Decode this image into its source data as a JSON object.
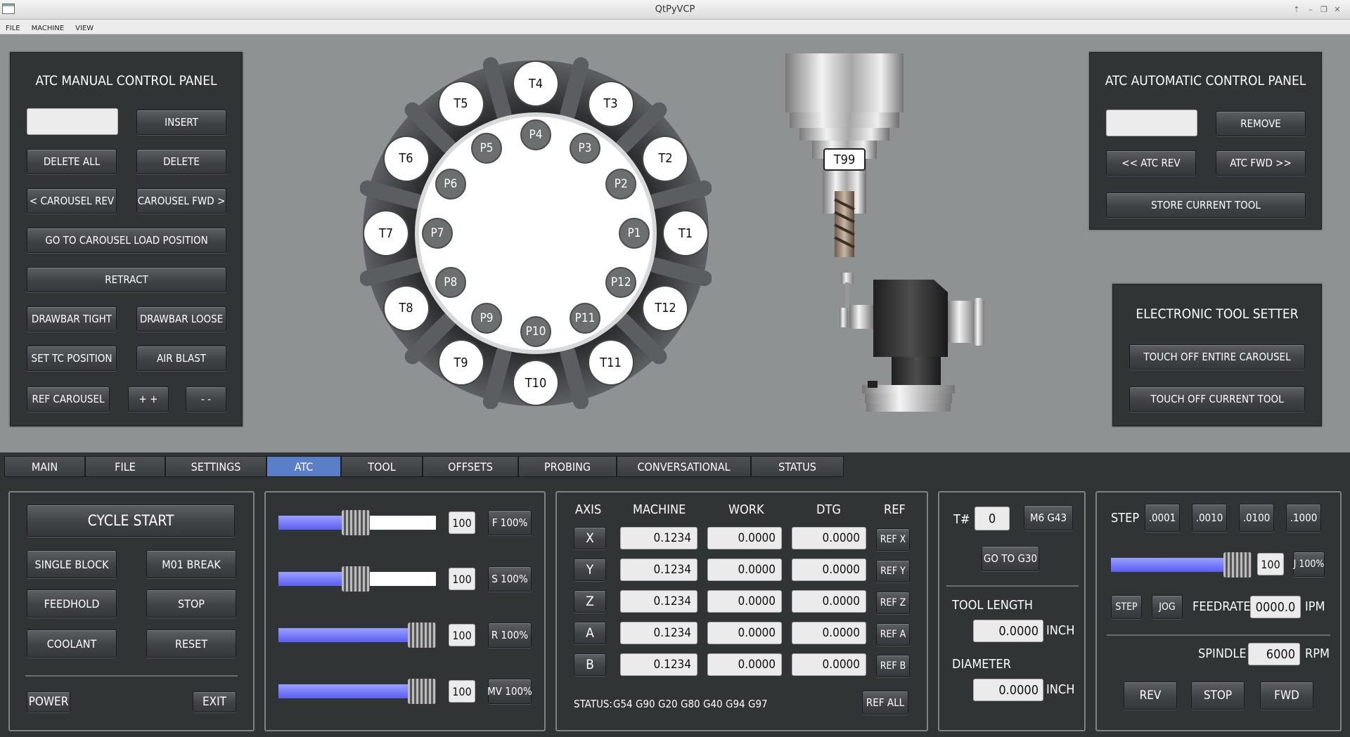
{
  "window": {
    "title": "QtPyVCP"
  },
  "menu": [
    "FILE",
    "MACHINE",
    "VIEW"
  ],
  "manual_panel": {
    "title": "ATC MANUAL CONTROL PANEL",
    "input_value": "",
    "insert": "INSERT",
    "delete_all": "DELETE ALL",
    "delete": "DELETE",
    "carousel_rev": "< CAROUSEL REV",
    "carousel_fwd": "CAROUSEL FWD >",
    "go_load": "GO TO CAROUSEL LOAD POSITION",
    "retract": "RETRACT",
    "drawbar_tight": "DRAWBAR TIGHT",
    "drawbar_loose": "DRAWBAR LOOSE",
    "set_tc": "SET TC POSITION",
    "air_blast": "AIR BLAST",
    "ref_carousel": "REF CAROUSEL",
    "plus": "+ +",
    "minus": "- -"
  },
  "carousel": {
    "tools": [
      "T1",
      "T2",
      "T3",
      "T4",
      "T5",
      "T6",
      "T7",
      "T8",
      "T9",
      "T10",
      "T11",
      "T12"
    ],
    "pockets": [
      "P1",
      "P2",
      "P3",
      "P4",
      "P5",
      "P6",
      "P7",
      "P8",
      "P9",
      "P10",
      "P11",
      "P12"
    ]
  },
  "spindle_tool": "T99",
  "auto_panel": {
    "title": "ATC AUTOMATIC CONTROL PANEL",
    "input_value": "",
    "remove": "REMOVE",
    "atc_rev": "<< ATC REV",
    "atc_fwd": "ATC FWD >>",
    "store": "STORE CURRENT TOOL"
  },
  "tool_setter": {
    "title": "ELECTRONIC TOOL SETTER",
    "touch_all": "TOUCH OFF ENTIRE CAROUSEL",
    "touch_current": "TOUCH OFF CURRENT TOOL"
  },
  "tabs": [
    "MAIN",
    "FILE",
    "SETTINGS",
    "ATC",
    "TOOL",
    "OFFSETS",
    "PROBING",
    "CONVERSATIONAL",
    "STATUS"
  ],
  "active_tab": "ATC",
  "cycle": {
    "cycle_start": "CYCLE START",
    "single_block": "SINGLE BLOCK",
    "m01": "M01 BREAK",
    "feedhold": "FEEDHOLD",
    "stop": "STOP",
    "coolant": "COOLANT",
    "reset": "RESET",
    "power": "POWER",
    "exit": "EXIT"
  },
  "overrides": [
    {
      "value": "100",
      "button": "F 100%",
      "level": 0.45
    },
    {
      "value": "100",
      "button": "S 100%",
      "level": 0.45
    },
    {
      "value": "100",
      "button": "R 100%",
      "level": 1.0
    },
    {
      "value": "100",
      "button": "MV 100%",
      "level": 1.0
    }
  ],
  "dro": {
    "headers": [
      "AXIS",
      "MACHINE",
      "WORK",
      "DTG",
      "REF"
    ],
    "rows": [
      {
        "axis": "X",
        "machine": "0.1234",
        "work": "0.0000",
        "dtg": "0.0000",
        "ref": "REF X"
      },
      {
        "axis": "Y",
        "machine": "0.1234",
        "work": "0.0000",
        "dtg": "0.0000",
        "ref": "REF Y"
      },
      {
        "axis": "Z",
        "machine": "0.1234",
        "work": "0.0000",
        "dtg": "0.0000",
        "ref": "REF Z"
      },
      {
        "axis": "A",
        "machine": "0.1234",
        "work": "0.0000",
        "dtg": "0.0000",
        "ref": "REF A"
      },
      {
        "axis": "B",
        "machine": "0.1234",
        "work": "0.0000",
        "dtg": "0.0000",
        "ref": "REF B"
      }
    ],
    "status_label": "STATUS:",
    "gcodes": [
      "G54",
      "G90",
      "G20",
      "G80",
      "G40",
      "G94",
      "G97"
    ],
    "ref_all": "REF ALL"
  },
  "tool": {
    "t_label": "T#",
    "t_value": "0",
    "m6": "M6 G43",
    "g30": "GO TO G30",
    "length_label": "TOOL LENGTH",
    "length_value": "0.0000",
    "length_unit": "INCH",
    "diameter_label": "DIAMETER",
    "diameter_value": "0.0000",
    "diameter_unit": "INCH"
  },
  "jog": {
    "step_label": "STEP",
    "steps": [
      ".0001",
      ".0010",
      ".0100",
      ".1000"
    ],
    "jog_value": "100",
    "jog_button": "J 100%",
    "jog_level": 1.0,
    "step_btn": "STEP",
    "jog_btn": "JOG",
    "feedrate_label": "FEEDRATE",
    "feedrate_value": "0000.0",
    "feedrate_unit": "IPM",
    "spindle_label": "SPINDLE",
    "spindle_value": "6000",
    "spindle_unit": "RPM",
    "rev": "REV",
    "stop": "STOP",
    "fwd": "FWD"
  }
}
